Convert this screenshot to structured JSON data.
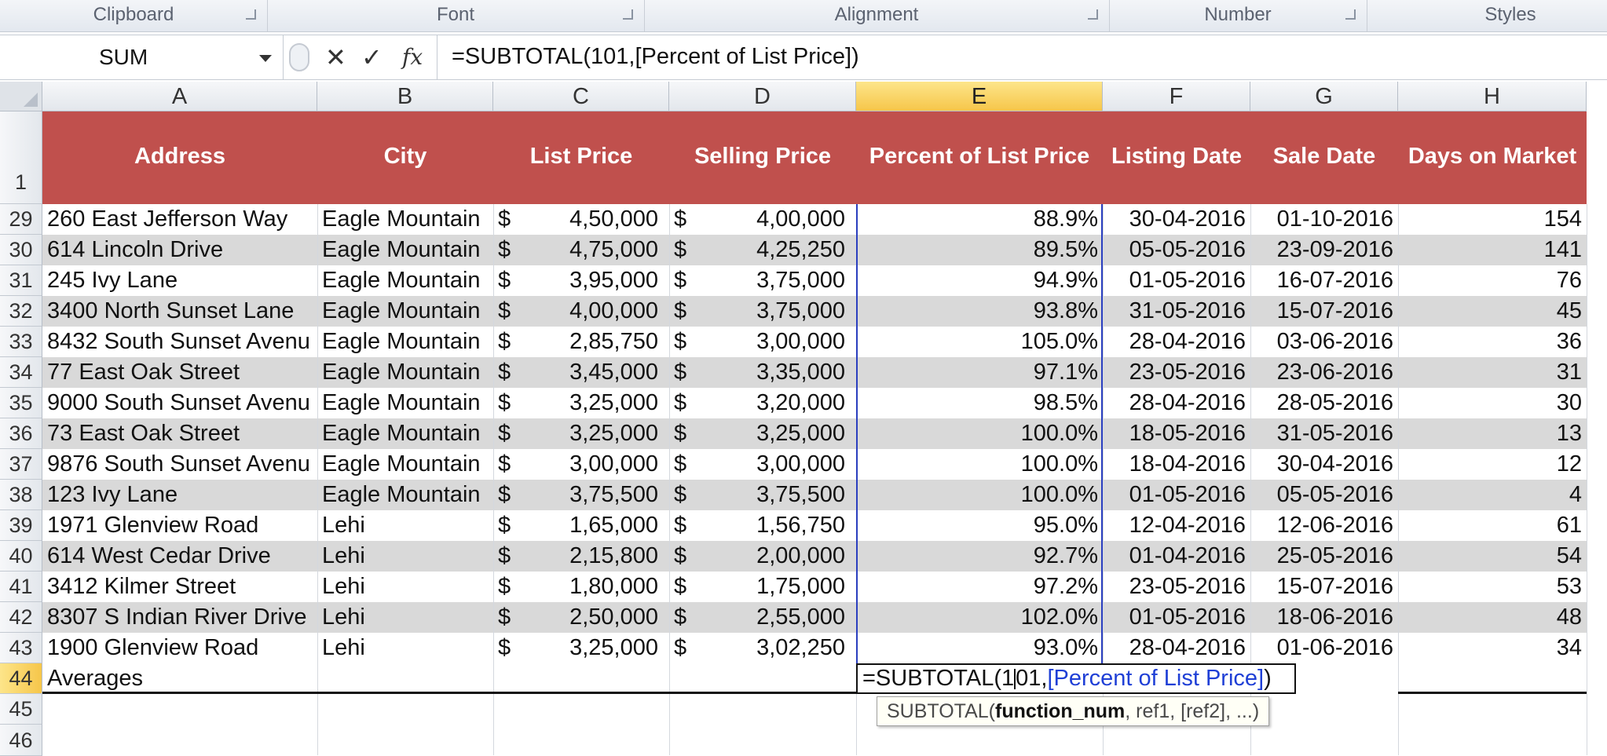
{
  "ribbon": {
    "groups": [
      {
        "label": "Clipboard"
      },
      {
        "label": "Font"
      },
      {
        "label": "Alignment"
      },
      {
        "label": "Number"
      },
      {
        "label": "Styles"
      }
    ]
  },
  "formula_bar": {
    "name_box": "SUM",
    "cancel_icon": "✕",
    "enter_icon": "✓",
    "fx_label": "fx",
    "formula": "=SUBTOTAL(101,[Percent of List Price])"
  },
  "columns": [
    "A",
    "B",
    "C",
    "D",
    "E",
    "F",
    "G",
    "H"
  ],
  "selected_column": "E",
  "header_row": {
    "row_number": "1",
    "labels": [
      "Address",
      "City",
      "List Price",
      "Selling Price",
      "Percent of List Price",
      "Listing Date",
      "Sale Date",
      "Days on Market"
    ]
  },
  "rows": [
    {
      "n": "29",
      "address": "260 East Jefferson Way",
      "city": "Eagle Mountain",
      "list_cur": "$",
      "list": "4,50,000",
      "sell_cur": "$",
      "sell": "4,00,000",
      "pct": "88.9%",
      "listing": "30-04-2016",
      "sale": "01-10-2016",
      "days": "154"
    },
    {
      "n": "30",
      "address": "614 Lincoln Drive",
      "city": "Eagle Mountain",
      "list_cur": "$",
      "list": "4,75,000",
      "sell_cur": "$",
      "sell": "4,25,250",
      "pct": "89.5%",
      "listing": "05-05-2016",
      "sale": "23-09-2016",
      "days": "141"
    },
    {
      "n": "31",
      "address": "245 Ivy Lane",
      "city": "Eagle Mountain",
      "list_cur": "$",
      "list": "3,95,000",
      "sell_cur": "$",
      "sell": "3,75,000",
      "pct": "94.9%",
      "listing": "01-05-2016",
      "sale": "16-07-2016",
      "days": "76"
    },
    {
      "n": "32",
      "address": "3400 North Sunset Lane",
      "city": "Eagle Mountain",
      "list_cur": "$",
      "list": "4,00,000",
      "sell_cur": "$",
      "sell": "3,75,000",
      "pct": "93.8%",
      "listing": "31-05-2016",
      "sale": "15-07-2016",
      "days": "45"
    },
    {
      "n": "33",
      "address": "8432 South Sunset Avenu",
      "city": "Eagle Mountain",
      "list_cur": "$",
      "list": "2,85,750",
      "sell_cur": "$",
      "sell": "3,00,000",
      "pct": "105.0%",
      "listing": "28-04-2016",
      "sale": "03-06-2016",
      "days": "36"
    },
    {
      "n": "34",
      "address": "77 East Oak Street",
      "city": "Eagle Mountain",
      "list_cur": "$",
      "list": "3,45,000",
      "sell_cur": "$",
      "sell": "3,35,000",
      "pct": "97.1%",
      "listing": "23-05-2016",
      "sale": "23-06-2016",
      "days": "31"
    },
    {
      "n": "35",
      "address": "9000 South Sunset Avenu",
      "city": "Eagle Mountain",
      "list_cur": "$",
      "list": "3,25,000",
      "sell_cur": "$",
      "sell": "3,20,000",
      "pct": "98.5%",
      "listing": "28-04-2016",
      "sale": "28-05-2016",
      "days": "30"
    },
    {
      "n": "36",
      "address": "73 East Oak Street",
      "city": "Eagle Mountain",
      "list_cur": "$",
      "list": "3,25,000",
      "sell_cur": "$",
      "sell": "3,25,000",
      "pct": "100.0%",
      "listing": "18-05-2016",
      "sale": "31-05-2016",
      "days": "13"
    },
    {
      "n": "37",
      "address": "9876 South Sunset Avenu",
      "city": "Eagle Mountain",
      "list_cur": "$",
      "list": "3,00,000",
      "sell_cur": "$",
      "sell": "3,00,000",
      "pct": "100.0%",
      "listing": "18-04-2016",
      "sale": "30-04-2016",
      "days": "12"
    },
    {
      "n": "38",
      "address": "123 Ivy Lane",
      "city": "Eagle Mountain",
      "list_cur": "$",
      "list": "3,75,500",
      "sell_cur": "$",
      "sell": "3,75,500",
      "pct": "100.0%",
      "listing": "01-05-2016",
      "sale": "05-05-2016",
      "days": "4"
    },
    {
      "n": "39",
      "address": "1971 Glenview Road",
      "city": "Lehi",
      "list_cur": "$",
      "list": "1,65,000",
      "sell_cur": "$",
      "sell": "1,56,750",
      "pct": "95.0%",
      "listing": "12-04-2016",
      "sale": "12-06-2016",
      "days": "61"
    },
    {
      "n": "40",
      "address": "614 West Cedar Drive",
      "city": "Lehi",
      "list_cur": "$",
      "list": "2,15,800",
      "sell_cur": "$",
      "sell": "2,00,000",
      "pct": "92.7%",
      "listing": "01-04-2016",
      "sale": "25-05-2016",
      "days": "54"
    },
    {
      "n": "41",
      "address": "3412 Kilmer Street",
      "city": "Lehi",
      "list_cur": "$",
      "list": "1,80,000",
      "sell_cur": "$",
      "sell": "1,75,000",
      "pct": "97.2%",
      "listing": "23-05-2016",
      "sale": "15-07-2016",
      "days": "53"
    },
    {
      "n": "42",
      "address": "8307 S Indian River Drive",
      "city": "Lehi",
      "list_cur": "$",
      "list": "2,50,000",
      "sell_cur": "$",
      "sell": "2,55,000",
      "pct": "102.0%",
      "listing": "01-05-2016",
      "sale": "18-06-2016",
      "days": "48"
    },
    {
      "n": "43",
      "address": "1900 Glenview Road",
      "city": "Lehi",
      "list_cur": "$",
      "list": "3,25,000",
      "sell_cur": "$",
      "sell": "3,02,250",
      "pct": "93.0%",
      "listing": "28-04-2016",
      "sale": "01-06-2016",
      "days": "34"
    }
  ],
  "totals_row": {
    "n": "44",
    "label": "Averages",
    "edit_prefix": "=SUBTOTAL(1",
    "edit_cursor_rest": "01,",
    "edit_ref": "[Percent of List Price]",
    "edit_suffix": ")"
  },
  "empty_rows": [
    "45",
    "46"
  ],
  "tooltip": {
    "fn": "SUBTOTAL(",
    "arg_bold": "function_num",
    "rest": ", ref1, [ref2], ...)"
  },
  "colors": {
    "header_fill": "#c0504d",
    "band_fill": "#d9d9d9",
    "selected_header": "#f6c64a",
    "ref_blue": "#1f3fd6"
  }
}
